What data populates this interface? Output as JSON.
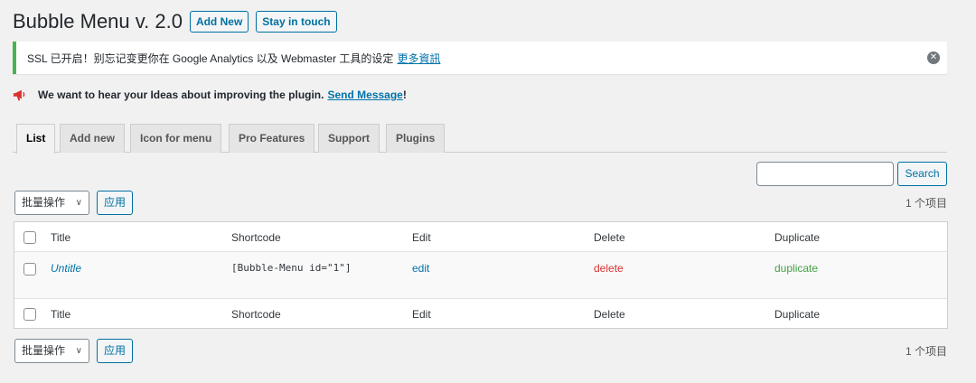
{
  "header": {
    "title": "Bubble Menu v. 2.0",
    "add_new": "Add New",
    "stay_in_touch": "Stay in touch"
  },
  "notice": {
    "text": "SSL 已开启！别忘记变更你在 Google Analytics 以及 Webmaster 工具的设定",
    "link": "更多資訊",
    "dismiss_icon": "dismiss-icon",
    "accent_color": "#46b450"
  },
  "ideas": {
    "icon": "megaphone-icon",
    "text": "We want to hear your Ideas about improving the plugin.",
    "link": "Send Message",
    "suffix": "!"
  },
  "tabs": [
    {
      "label": "List",
      "active": true
    },
    {
      "label": "Add new"
    },
    {
      "label": "Icon for menu"
    },
    {
      "label": "Pro Features"
    },
    {
      "label": "Support"
    },
    {
      "label": "Plugins"
    }
  ],
  "search": {
    "value": "",
    "button": "Search"
  },
  "bulk": {
    "select": "批量操作",
    "apply": "应用",
    "count": "1 个项目"
  },
  "table": {
    "columns": [
      "Title",
      "Shortcode",
      "Edit",
      "Delete",
      "Duplicate"
    ],
    "rows": [
      {
        "title": "Untitle",
        "shortcode": "[Bubble-Menu id=\"1\"]",
        "edit": "edit",
        "delete": "delete",
        "duplicate": "duplicate"
      }
    ]
  },
  "colors": {
    "link": "#0073aa",
    "delete": "#dc3232",
    "duplicate": "#46a046",
    "megaphone": "#dc3232"
  }
}
